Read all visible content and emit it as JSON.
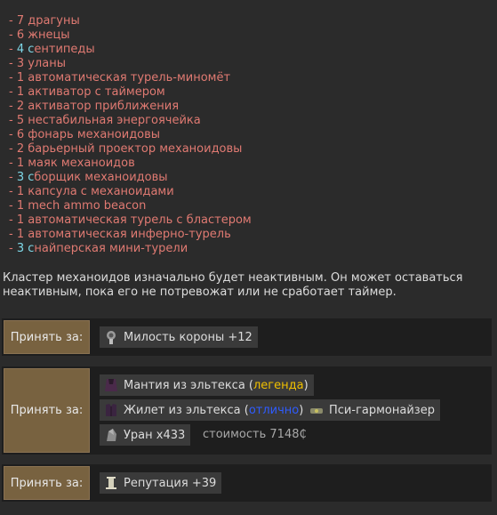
{
  "items": [
    {
      "prefix": "- ",
      "num": "7",
      "text": " драгуны",
      "cyan": false
    },
    {
      "prefix": "- ",
      "num": "6",
      "text": " жнецы",
      "cyan": false
    },
    {
      "prefix": "- ",
      "num": "4",
      "first": " с",
      "text": "ентипеды",
      "cyan": true
    },
    {
      "prefix": "- ",
      "num": "3",
      "text": " уланы",
      "cyan": false
    },
    {
      "prefix": "- ",
      "num": "1",
      "text": " автоматическая турель-миномёт",
      "cyan": false
    },
    {
      "prefix": "- ",
      "num": "1",
      "text": " активатор с таймером",
      "cyan": false
    },
    {
      "prefix": "- ",
      "num": "2",
      "text": " активатор приближения",
      "cyan": false
    },
    {
      "prefix": "- ",
      "num": "5",
      "text": " нестабильная энергоячейка",
      "cyan": false
    },
    {
      "prefix": "- ",
      "num": "6",
      "text": " фонарь механоидовы",
      "cyan": false
    },
    {
      "prefix": "- ",
      "num": "2",
      "text": " барьерный проектор механоидовы",
      "cyan": false
    },
    {
      "prefix": "- ",
      "num": "1",
      "text": " маяк механоидов",
      "cyan": false
    },
    {
      "prefix": "- ",
      "num": "3",
      "first": " с",
      "text": "борщик механоидовы",
      "cyan": true
    },
    {
      "prefix": "- ",
      "num": "1",
      "text": " капсула с механоидами",
      "cyan": false
    },
    {
      "prefix": "- ",
      "num": "1",
      "text": " mech ammo beacon",
      "cyan": false
    },
    {
      "prefix": "- ",
      "num": "1",
      "text": " автоматическая турель с бластером",
      "cyan": false
    },
    {
      "prefix": "- ",
      "num": "1",
      "text": " автоматическая инферно-турель",
      "cyan": false
    },
    {
      "prefix": "- ",
      "num": "3",
      "first": " с",
      "text": "найперская мини-турели",
      "cyan": true
    }
  ],
  "description": "Кластер механоидов изначально будет неактивным. Он может оставаться неактивным, пока его не потревожат или не сработает таймер.",
  "offers": [
    {
      "accept_label": "Принять за:",
      "rewards": {
        "goodwill": {
          "icon": "crown-icon",
          "label": "Милость короны +12"
        }
      }
    },
    {
      "accept_label": "Принять за:",
      "rewards": {
        "mantle": {
          "icon": "mantle-icon",
          "name": "Мантия из эльтекса (",
          "quality": "легенда",
          "close": ")"
        },
        "vest": {
          "icon": "vest-icon",
          "name": "Жилет из эльтекса (",
          "quality": "отлично",
          "close": ")"
        },
        "harmonizer": {
          "icon": "psychic-harmonizer-icon",
          "label": "Пси-гармонайзер"
        },
        "uranium": {
          "icon": "uranium-icon",
          "label": "Уран x433"
        },
        "cost": "стоимость 7148₵"
      }
    },
    {
      "accept_label": "Принять за:",
      "rewards": {
        "reputation": {
          "icon": "pillar-icon",
          "label": "Репутация +39"
        }
      }
    }
  ],
  "colors": {
    "background": "#2b2b2b",
    "item_text": "#e07a72",
    "highlight": "#7fd8e8",
    "accept_button": "#786240",
    "legendary": "#f0c000",
    "excellent": "#2f5cff"
  }
}
